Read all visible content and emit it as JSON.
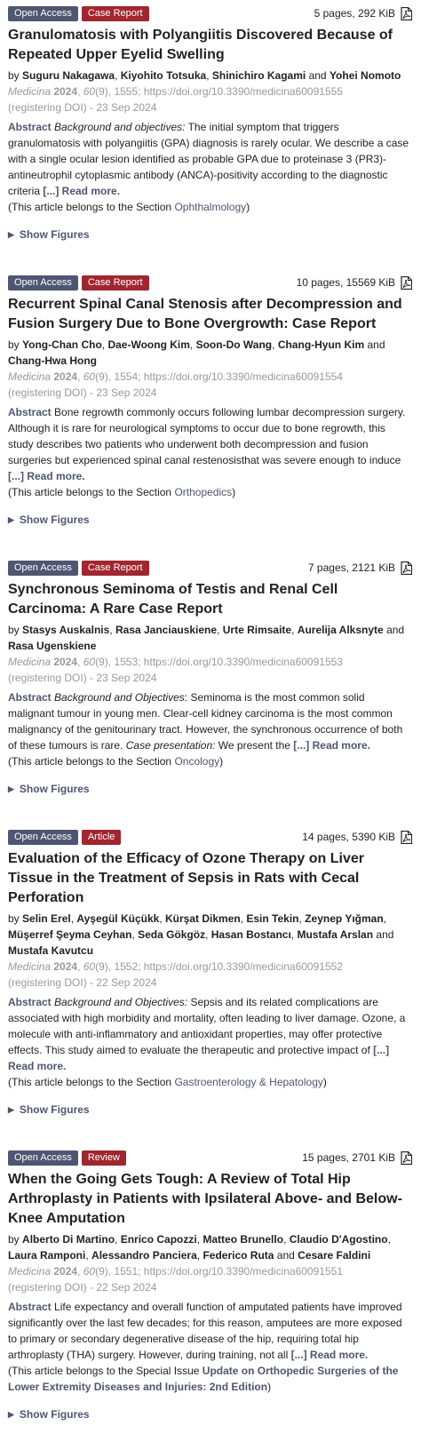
{
  "articles": [
    {
      "badge_oa": "Open Access",
      "badge_type": "Case Report",
      "pages": "5 pages, 292 KiB",
      "title": "Granulomatosis with Polyangiitis Discovered Because of Repeated Upper Eyelid Swelling",
      "by": "by",
      "authors": [
        "Suguru Nakagawa",
        "Kiyohito Totsuka",
        "Shinichiro Kagami",
        "Yohei Nomoto"
      ],
      "journal": "Medicina",
      "year": "2024",
      "volume": "60",
      "issue_rest": "(9), 1555; https://doi.org/10.3390/medicina60091555",
      "date_line": "(registering DOI) - 23 Sep 2024",
      "abstract_label": "Abstract",
      "abstract_intro_italic": "Background and objectives:",
      "abstract_text": " The initial symptom that triggers granulomatosis with polyangiitis (GPA) diagnosis is rarely ocular. We describe a case with a single ocular lesion identified as probable GPA due to proteinase 3 (PR3)-antineutrophil cytoplasmic antibody (ANCA)-positivity according to the diagnostic criteria ",
      "read_more": "[...] Read more.",
      "section_prefix": "(This article belongs to the Section ",
      "section_name": "Ophthalmology",
      "section_bold": false,
      "section_suffix": ")",
      "show_figures": "Show Figures"
    },
    {
      "badge_oa": "Open Access",
      "badge_type": "Case Report",
      "pages": "10 pages, 15569 KiB",
      "title": "Recurrent Spinal Canal Stenosis after Decompression and Fusion Surgery Due to Bone Overgrowth: Case Report",
      "by": "by",
      "authors": [
        "Yong-Chan Cho",
        "Dae-Woong Kim",
        "Soon-Do Wang",
        "Chang-Hyun Kim",
        "Chang-Hwa Hong"
      ],
      "journal": "Medicina",
      "year": "2024",
      "volume": "60",
      "issue_rest": "(9), 1554; https://doi.org/10.3390/medicina60091554",
      "date_line": "(registering DOI) - 23 Sep 2024",
      "abstract_label": "Abstract",
      "abstract_intro_italic": "",
      "abstract_text": " Bone regrowth commonly occurs following lumbar decompression surgery. Although it is rare for neurological symptoms to occur due to bone regrowth, this study describes two patients who underwent both decompression and fusion surgeries but experienced spinal canal restenosisthat was severe enough to induce ",
      "read_more": "[...] Read more.",
      "section_prefix": "(This article belongs to the Section ",
      "section_name": "Orthopedics",
      "section_bold": false,
      "section_suffix": ")",
      "show_figures": "Show Figures"
    },
    {
      "badge_oa": "Open Access",
      "badge_type": "Case Report",
      "pages": "7 pages, 2121 KiB",
      "title": "Synchronous Seminoma of Testis and Renal Cell Carcinoma: A Rare Case Report",
      "by": "by",
      "authors": [
        "Stasys Auskalnis",
        "Rasa Janciauskiene",
        "Urte Rimsaite",
        "Aurelija Alksnyte",
        "Rasa Ugenskiene"
      ],
      "journal": "Medicina",
      "year": "2024",
      "volume": "60",
      "issue_rest": "(9), 1553; https://doi.org/10.3390/medicina60091553",
      "date_line": "(registering DOI) - 23 Sep 2024",
      "abstract_label": "Abstract",
      "abstract_intro_italic": "Background and Objectives",
      "abstract_text": ": Seminoma is the most common solid malignant tumour in young men. Clear-cell kidney carcinoma is the most common malignancy of the genitourinary tract. However, the synchronous occurrence of both of these tumours is rare. ",
      "abstract_mid_italic": "Case presentation:",
      "abstract_text2": " We present the ",
      "read_more": "[...] Read more.",
      "section_prefix": "(This article belongs to the Section ",
      "section_name": "Oncology",
      "section_bold": false,
      "section_suffix": ")",
      "show_figures": "Show Figures"
    },
    {
      "badge_oa": "Open Access",
      "badge_type": "Article",
      "pages": "14 pages, 5390 KiB",
      "title": "Evaluation of the Efficacy of Ozone Therapy on Liver Tissue in the Treatment of Sepsis in Rats with Cecal Perforation",
      "by": "by",
      "authors": [
        "Selin Erel",
        "Ayşegül Küçükk",
        "Kürşat Dikmen",
        "Esin Tekin",
        "Zeynep Yığman",
        "Müşerref Şeyma Ceyhan",
        "Seda Gökgöz",
        "Hasan Bostancı",
        "Mustafa Arslan",
        "Mustafa Kavutcu"
      ],
      "journal": "Medicina",
      "year": "2024",
      "volume": "60",
      "issue_rest": "(9), 1552; https://doi.org/10.3390/medicina60091552",
      "date_line": "(registering DOI) - 22 Sep 2024",
      "abstract_label": "Abstract",
      "abstract_intro_italic": "Background and Objectives:",
      "abstract_text": " Sepsis and its related complications are associated with high morbidity and mortality, often leading to liver damage. Ozone, a molecule with anti-inflammatory and antioxidant properties, may offer protective effects. This study aimed to evaluate the therapeutic and protective impact of ",
      "read_more": "[...] Read more.",
      "section_prefix": "(This article belongs to the Section ",
      "section_name": "Gastroenterology & Hepatology",
      "section_bold": false,
      "section_suffix": ")",
      "show_figures": "Show Figures"
    },
    {
      "badge_oa": "Open Access",
      "badge_type": "Review",
      "pages": "15 pages, 2701 KiB",
      "title": "When the Going Gets Tough: A Review of Total Hip Arthroplasty in Patients with Ipsilateral Above- and Below-Knee Amputation",
      "by": "by",
      "authors": [
        "Alberto Di Martino",
        "Enrico Capozzi",
        "Matteo Brunello",
        "Claudio D'Agostino",
        "Laura Ramponi",
        "Alessandro Panciera",
        "Federico Ruta",
        "Cesare Faldini"
      ],
      "journal": "Medicina",
      "year": "2024",
      "volume": "60",
      "issue_rest": "(9), 1551; https://doi.org/10.3390/medicina60091551",
      "date_line": "(registering DOI) - 22 Sep 2024",
      "abstract_label": "Abstract",
      "abstract_intro_italic": "",
      "abstract_text": " Life expectancy and overall function of amputated patients have improved significantly over the last few decades; for this reason, amputees are more exposed to primary or secondary degenerative disease of the hip, requiring total hip arthroplasty (THA) surgery. However, during training, not all ",
      "read_more": "[...] Read more.",
      "section_prefix": "(This article belongs to the Special Issue ",
      "section_name": "Update on Orthopedic Surgeries of the Lower Extremity Diseases and Injuries: 2nd Edition",
      "section_bold": true,
      "section_suffix": ")",
      "show_figures": "Show Figures"
    }
  ],
  "icons": {
    "pdf": "pdf-file-icon",
    "show_figures": "triangle-right-icon"
  },
  "colors": {
    "open_access_badge": "#4f5671",
    "type_badge": "#a0262f",
    "link": "#4f5671",
    "meta": "#999999"
  },
  "and_word": "and"
}
